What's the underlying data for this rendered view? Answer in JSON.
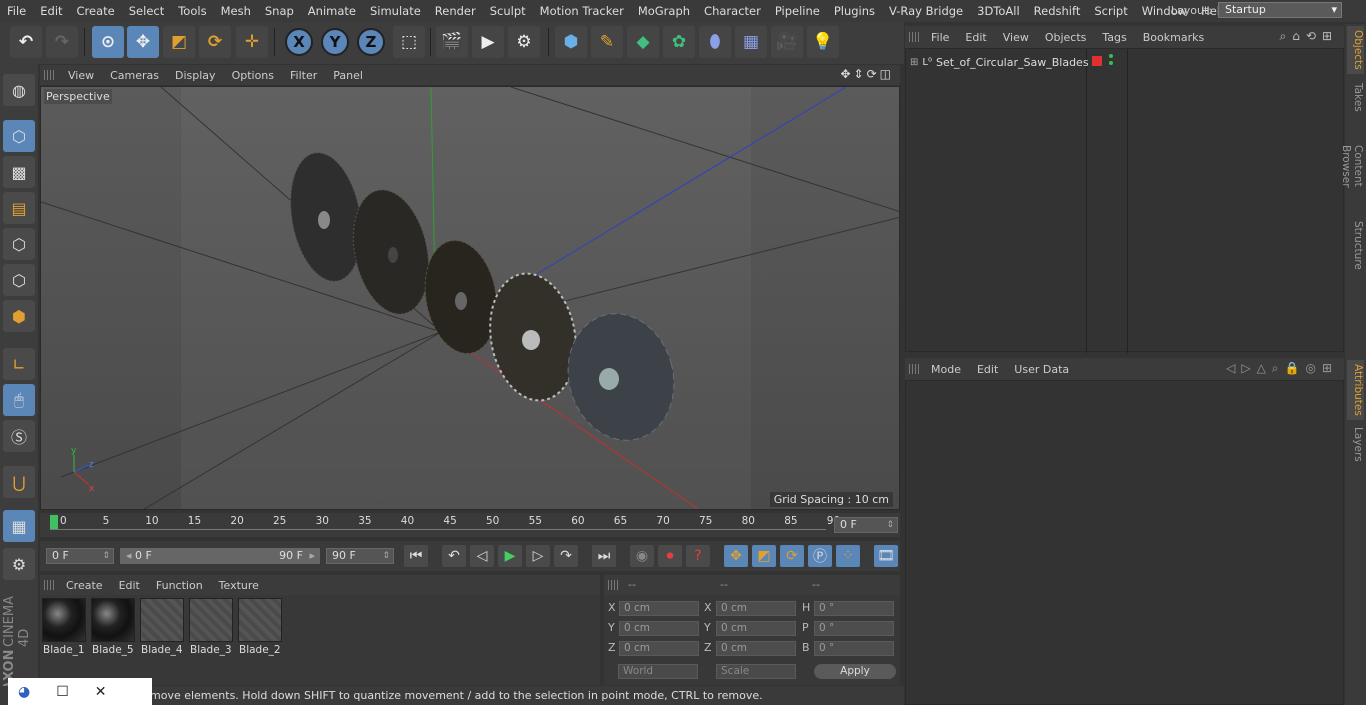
{
  "menubar": {
    "items": [
      "File",
      "Edit",
      "Create",
      "Select",
      "Tools",
      "Mesh",
      "Snap",
      "Animate",
      "Simulate",
      "Render",
      "Sculpt",
      "Motion Tracker",
      "MoGraph",
      "Character",
      "Pipeline",
      "Plugins",
      "V-Ray Bridge",
      "3DToAll",
      "Redshift",
      "Script",
      "Window",
      "Help"
    ],
    "layout_label": "Layout:",
    "layout_value": "Startup"
  },
  "toolbar": {
    "axis_x": "X",
    "axis_y": "Y",
    "axis_z": "Z"
  },
  "viewport": {
    "menu": [
      "View",
      "Cameras",
      "Display",
      "Options",
      "Filter",
      "Panel"
    ],
    "label": "Perspective",
    "grid_spacing": "Grid Spacing : 10 cm",
    "axis_x": "x",
    "axis_y": "y",
    "axis_z": "z"
  },
  "timeline": {
    "ticks": [
      "0",
      "5",
      "10",
      "15",
      "20",
      "25",
      "30",
      "35",
      "40",
      "45",
      "50",
      "55",
      "60",
      "65",
      "70",
      "75",
      "80",
      "85",
      "90"
    ],
    "current_frame": "0 F"
  },
  "transport": {
    "start": "0 F",
    "range_start": "0 F",
    "range_end": "90 F",
    "end": "90 F"
  },
  "materials": {
    "menu": [
      "Create",
      "Edit",
      "Function",
      "Texture"
    ],
    "items": [
      {
        "name": "Blade_1",
        "type": "ball"
      },
      {
        "name": "Blade_5",
        "type": "ball"
      },
      {
        "name": "Blade_4",
        "type": "empty"
      },
      {
        "name": "Blade_3",
        "type": "empty"
      },
      {
        "name": "Blade_2",
        "type": "empty"
      }
    ]
  },
  "coords": {
    "headers": [
      "--",
      "--",
      "--"
    ],
    "rows": [
      {
        "a": "X",
        "av": "0 cm",
        "b": "X",
        "bv": "0 cm",
        "c": "H",
        "cv": "0 °"
      },
      {
        "a": "Y",
        "av": "0 cm",
        "b": "Y",
        "bv": "0 cm",
        "c": "P",
        "cv": "0 °"
      },
      {
        "a": "Z",
        "av": "0 cm",
        "b": "Z",
        "bv": "0 cm",
        "c": "B",
        "cv": "0 °"
      }
    ],
    "space": "World",
    "mode": "Scale",
    "apply": "Apply"
  },
  "status": "move elements. Hold down SHIFT to quantize movement / add to the selection in point mode, CTRL to remove.",
  "objects": {
    "menu": [
      "File",
      "Edit",
      "View",
      "Objects",
      "Tags",
      "Bookmarks"
    ],
    "item": "Set_of_Circular_Saw_Blades"
  },
  "attributes": {
    "menu": [
      "Mode",
      "Edit",
      "User Data"
    ]
  },
  "sidetabs": [
    "Objects",
    "Takes",
    "Content Browser",
    "Structure",
    "Attributes",
    "Layers"
  ],
  "brand": {
    "maxon": "MAXON",
    "c4d": "CINEMA 4D"
  },
  "colors": {
    "accent": "#5a86b8",
    "tab_active": "#e0a030",
    "object_red": "#e03030",
    "object_green": "#30c050"
  }
}
